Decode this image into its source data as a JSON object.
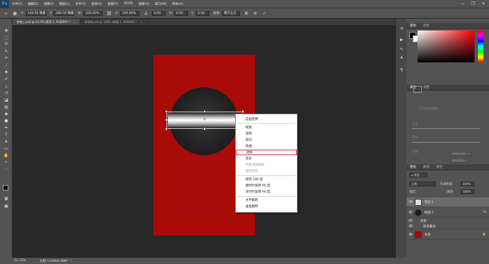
{
  "app": {
    "logo": "Ps"
  },
  "menubar": [
    "文件(F)",
    "编辑(E)",
    "图像(I)",
    "图层(L)",
    "文字(Y)",
    "选择(S)",
    "滤镜(T)",
    "3D(D)",
    "视图(V)",
    "窗口(W)",
    "帮助(H)"
  ],
  "window_controls": {
    "minimize": "—",
    "maximize": "❐",
    "close": "✕"
  },
  "options": {
    "x_label": "X:",
    "x_value": "344.50 像素",
    "y_label": "Y:",
    "y_value": "380.50 像素",
    "w_label": "W:",
    "w_value": "100.00%",
    "h_label": "H:",
    "h_value": "100.00%",
    "angle_value": "0.00",
    "hskew_label": "H:",
    "hskew_value": "0.00",
    "vskew_label": "V:",
    "vskew_value": "0.00",
    "interp_label": "插值:",
    "interp_value": "两次立方",
    "cancel": "⊘",
    "commit": "✓"
  },
  "tabs": [
    {
      "label": "奔驰三.psd @ 33.3% (矩形 1, RGB/8#) *",
      "close": "×"
    },
    {
      "label": "奔驰笔.psd @ 100% (椭圆 1, RGB/8#) *",
      "close": "×"
    }
  ],
  "context_menu": {
    "items": [
      "自由变换",
      "缩放",
      "旋转",
      "斜切",
      "扭曲",
      "透视",
      "变形",
      "内容识别缩放",
      "操控变形",
      "旋转 180 度",
      "顺时针旋转 90 度",
      "逆时针旋转 90 度",
      "水平翻转",
      "垂直翻转"
    ],
    "highlighted": "透视"
  },
  "status": {
    "zoom": "33.33%",
    "doc": "文档:3.00M/6.88M",
    "arrow": "›"
  },
  "color_panel": {
    "tab1": "颜色",
    "tab2": "色板"
  },
  "properties_panel": {
    "tab1": "属性",
    "tab2": "调整",
    "label_live": "实时形状属性",
    "label_density": "浓度",
    "label_feather": "羽化",
    "label_refine": "调整",
    "btn_select": "选择并遮住...",
    "btn_color_range": "颜色范围...",
    "btn_invert": "反相"
  },
  "layers_panel": {
    "tabs": [
      "图层",
      "通道",
      "路径"
    ],
    "filter": "ρ 类型",
    "blend": "正常",
    "opacity_label": "不透明度:",
    "opacity": "100%",
    "lock_label": "锁定:",
    "fill_label": "填充:",
    "fill": "100%",
    "layers": [
      {
        "name": "矩形 1"
      },
      {
        "name": "椭圆 1"
      },
      {
        "name": "效果"
      },
      {
        "name": "渐变叠加"
      },
      {
        "name": "背景"
      }
    ]
  },
  "colors": {
    "doc_bg": "#a80b08",
    "ui_bg": "#535353",
    "highlight": "#d6363e"
  }
}
